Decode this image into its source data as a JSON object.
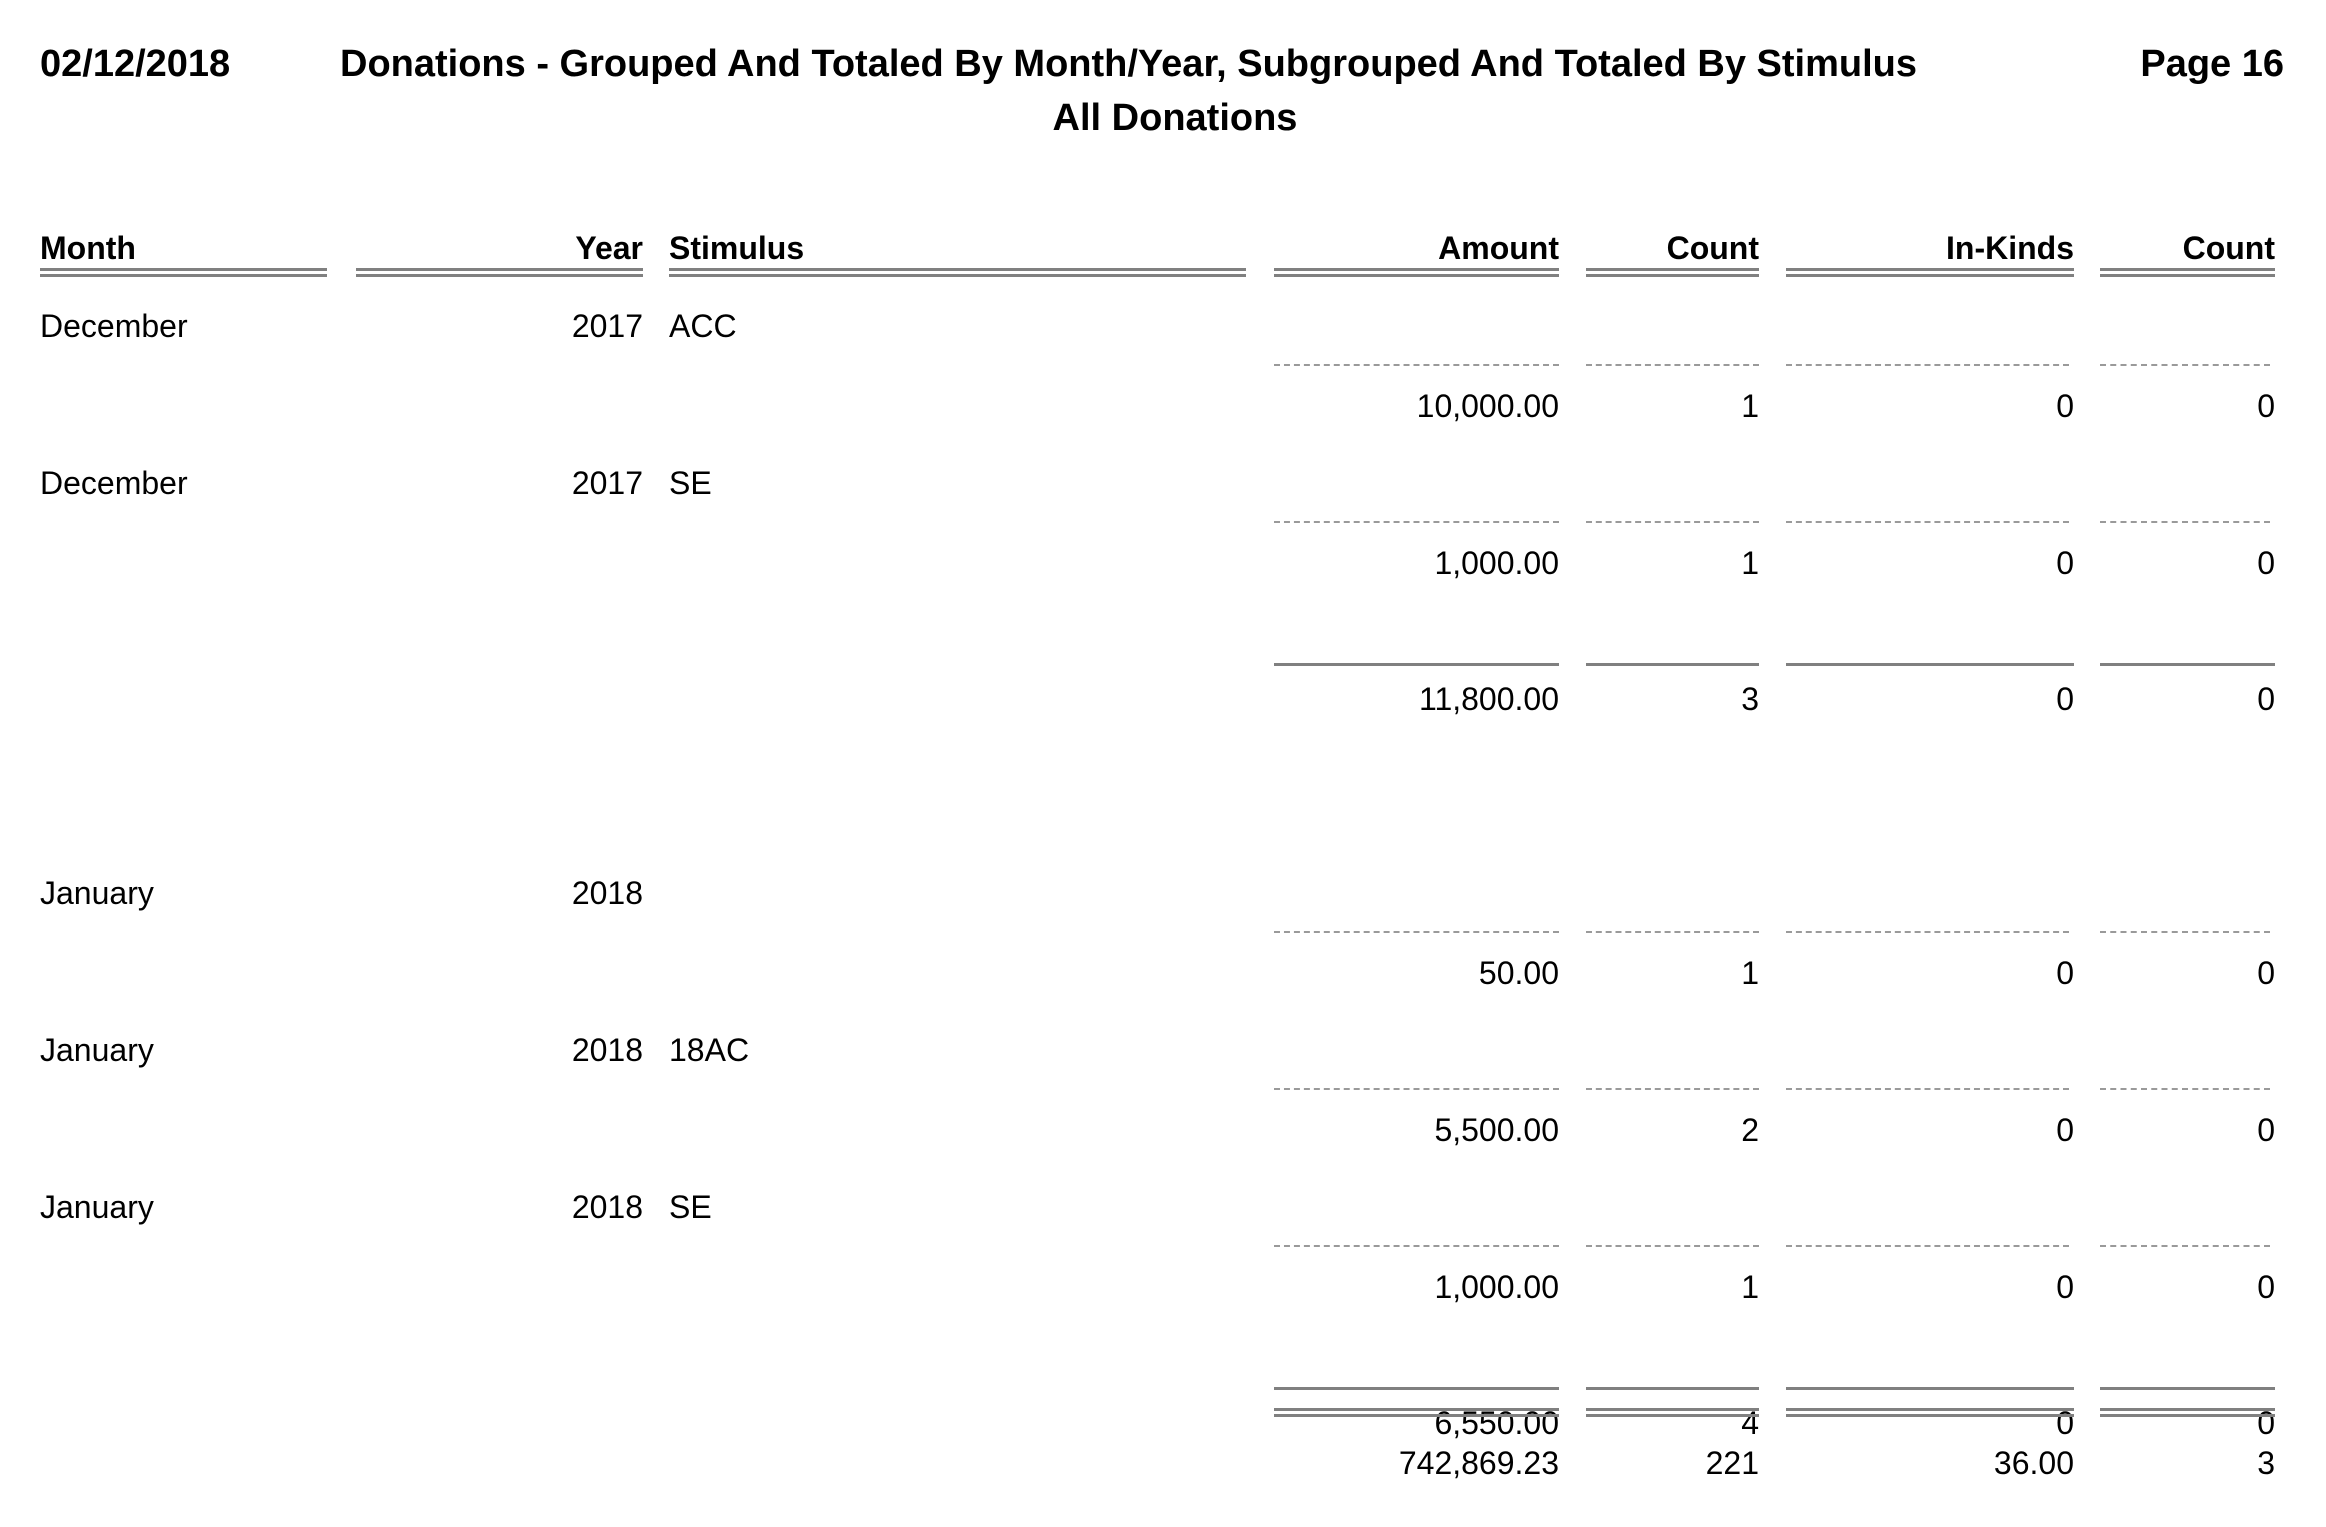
{
  "header": {
    "date": "02/12/2018",
    "title": "Donations - Grouped And Totaled By Month/Year, Subgrouped And Totaled By Stimulus",
    "subtitle": "All Donations",
    "page": "Page 16"
  },
  "columns": {
    "month": "Month",
    "year": "Year",
    "stimulus": "Stimulus",
    "amount": "Amount",
    "count": "Count",
    "inkinds": "In-Kinds",
    "inkind_count": "Count"
  },
  "groups": [
    {
      "rows": [
        {
          "month": "December",
          "year": "2017",
          "stimulus": "ACC",
          "amount": "10,000.00",
          "count": "1",
          "inkinds": "0",
          "inkind_count": "0"
        },
        {
          "month": "December",
          "year": "2017",
          "stimulus": "SE",
          "amount": "1,000.00",
          "count": "1",
          "inkinds": "0",
          "inkind_count": "0"
        }
      ],
      "total": {
        "amount": "11,800.00",
        "count": "3",
        "inkinds": "0",
        "inkind_count": "0"
      }
    },
    {
      "rows": [
        {
          "month": "January",
          "year": "2018",
          "stimulus": "",
          "amount": "50.00",
          "count": "1",
          "inkinds": "0",
          "inkind_count": "0"
        },
        {
          "month": "January",
          "year": "2018",
          "stimulus": "18AC",
          "amount": "5,500.00",
          "count": "2",
          "inkinds": "0",
          "inkind_count": "0"
        },
        {
          "month": "January",
          "year": "2018",
          "stimulus": "SE",
          "amount": "1,000.00",
          "count": "1",
          "inkinds": "0",
          "inkind_count": "0"
        }
      ],
      "total": {
        "amount": "6,550.00",
        "count": "4",
        "inkinds": "0",
        "inkind_count": "0"
      }
    }
  ],
  "grand_total": {
    "amount": "742,869.23",
    "count": "221",
    "inkinds": "36.00",
    "inkind_count": "3"
  }
}
